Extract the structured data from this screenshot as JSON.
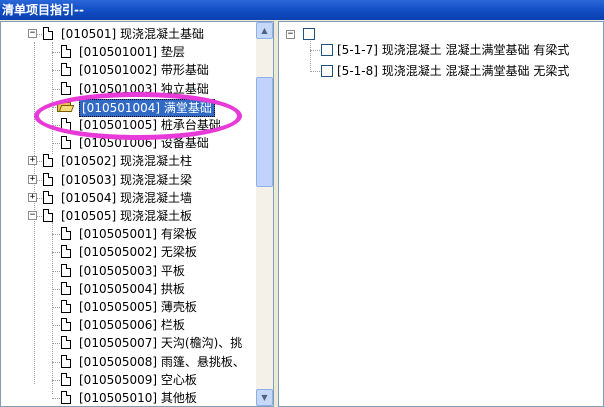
{
  "window": {
    "title": "清单项目指引--"
  },
  "left_tree": {
    "items": [
      {
        "level": 1,
        "expander": "−",
        "icon": "doc",
        "label": "[010501] 现浇混凝土基础"
      },
      {
        "level": 2,
        "expander": "",
        "icon": "doc",
        "label": "[010501001] 垫层"
      },
      {
        "level": 2,
        "expander": "",
        "icon": "doc",
        "label": "[010501002] 带形基础"
      },
      {
        "level": 2,
        "expander": "",
        "icon": "doc",
        "label": "[010501003] 独立基础"
      },
      {
        "level": 2,
        "expander": "",
        "icon": "folder-open",
        "label": "[010501004] 满堂基础",
        "selected": true
      },
      {
        "level": 2,
        "expander": "",
        "icon": "doc",
        "label": "[010501005] 桩承台基础"
      },
      {
        "level": 2,
        "expander": "",
        "icon": "doc",
        "label": "[010501006] 设备基础"
      },
      {
        "level": 1,
        "expander": "+",
        "icon": "doc",
        "label": "[010502] 现浇混凝土柱"
      },
      {
        "level": 1,
        "expander": "+",
        "icon": "doc",
        "label": "[010503] 现浇混凝土梁"
      },
      {
        "level": 1,
        "expander": "+",
        "icon": "doc",
        "label": "[010504] 现浇混凝土墙"
      },
      {
        "level": 1,
        "expander": "−",
        "icon": "doc",
        "label": "[010505] 现浇混凝土板"
      },
      {
        "level": 2,
        "expander": "",
        "icon": "doc",
        "label": "[010505001] 有梁板"
      },
      {
        "level": 2,
        "expander": "",
        "icon": "doc",
        "label": "[010505002] 无梁板"
      },
      {
        "level": 2,
        "expander": "",
        "icon": "doc",
        "label": "[010505003] 平板"
      },
      {
        "level": 2,
        "expander": "",
        "icon": "doc",
        "label": "[010505004] 拱板"
      },
      {
        "level": 2,
        "expander": "",
        "icon": "doc",
        "label": "[010505005] 薄壳板"
      },
      {
        "level": 2,
        "expander": "",
        "icon": "doc",
        "label": "[010505006] 栏板"
      },
      {
        "level": 2,
        "expander": "",
        "icon": "doc",
        "label": "[010505007] 天沟(檐沟)、挑"
      },
      {
        "level": 2,
        "expander": "",
        "icon": "doc",
        "label": "[010505008] 雨篷、悬挑板、"
      },
      {
        "level": 2,
        "expander": "",
        "icon": "doc",
        "label": "[010505009] 空心板"
      },
      {
        "level": 2,
        "expander": "",
        "icon": "doc",
        "label": "[010505010] 其他板"
      }
    ],
    "scrollbar": {
      "up_arrow": "▲",
      "down_arrow": "▼"
    }
  },
  "right_tree": {
    "root_expander": "−",
    "items": [
      {
        "label": "[5-1-7] 现浇混凝土 混凝土满堂基础 有梁式",
        "checked": false
      },
      {
        "label": "[5-1-8] 现浇混凝土 混凝土满堂基础 无梁式",
        "checked": false
      }
    ]
  },
  "colors": {
    "titlebar": "#1550c6",
    "selection": "#316ac5",
    "annotation_ellipse": "#e83ad8"
  }
}
